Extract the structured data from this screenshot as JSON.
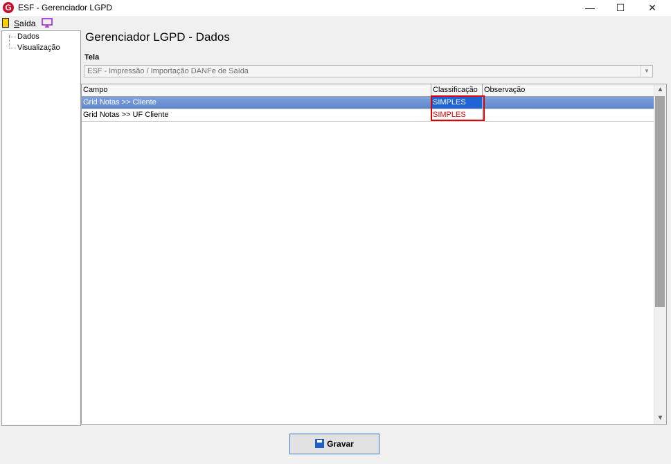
{
  "window": {
    "title": "ESF - Gerenciador LGPD",
    "app_icon_letter": "G",
    "minimize": "—",
    "maximize": "☐",
    "close": "✕"
  },
  "toolbar": {
    "exit_label": "Saída"
  },
  "tree": {
    "items": [
      "Dados",
      "Visualização"
    ]
  },
  "page": {
    "title": "Gerenciador LGPD - Dados",
    "tela_label": "Tela",
    "tela_value": "ESF - Impressão / Importação DANFe de Saída"
  },
  "grid": {
    "columns": [
      "Campo",
      "Classificação",
      "Observação"
    ],
    "rows": [
      {
        "campo": "Grid Notas >> Cliente",
        "classificacao": "SIMPLES",
        "observacao": ""
      },
      {
        "campo": "Grid Notas >> UF Cliente",
        "classificacao": "SIMPLES",
        "observacao": ""
      }
    ]
  },
  "footer": {
    "save_label": "Gravar"
  },
  "colors": {
    "selection": "#5f86cb",
    "highlight": "#e00000",
    "accent": "#3579c4"
  }
}
